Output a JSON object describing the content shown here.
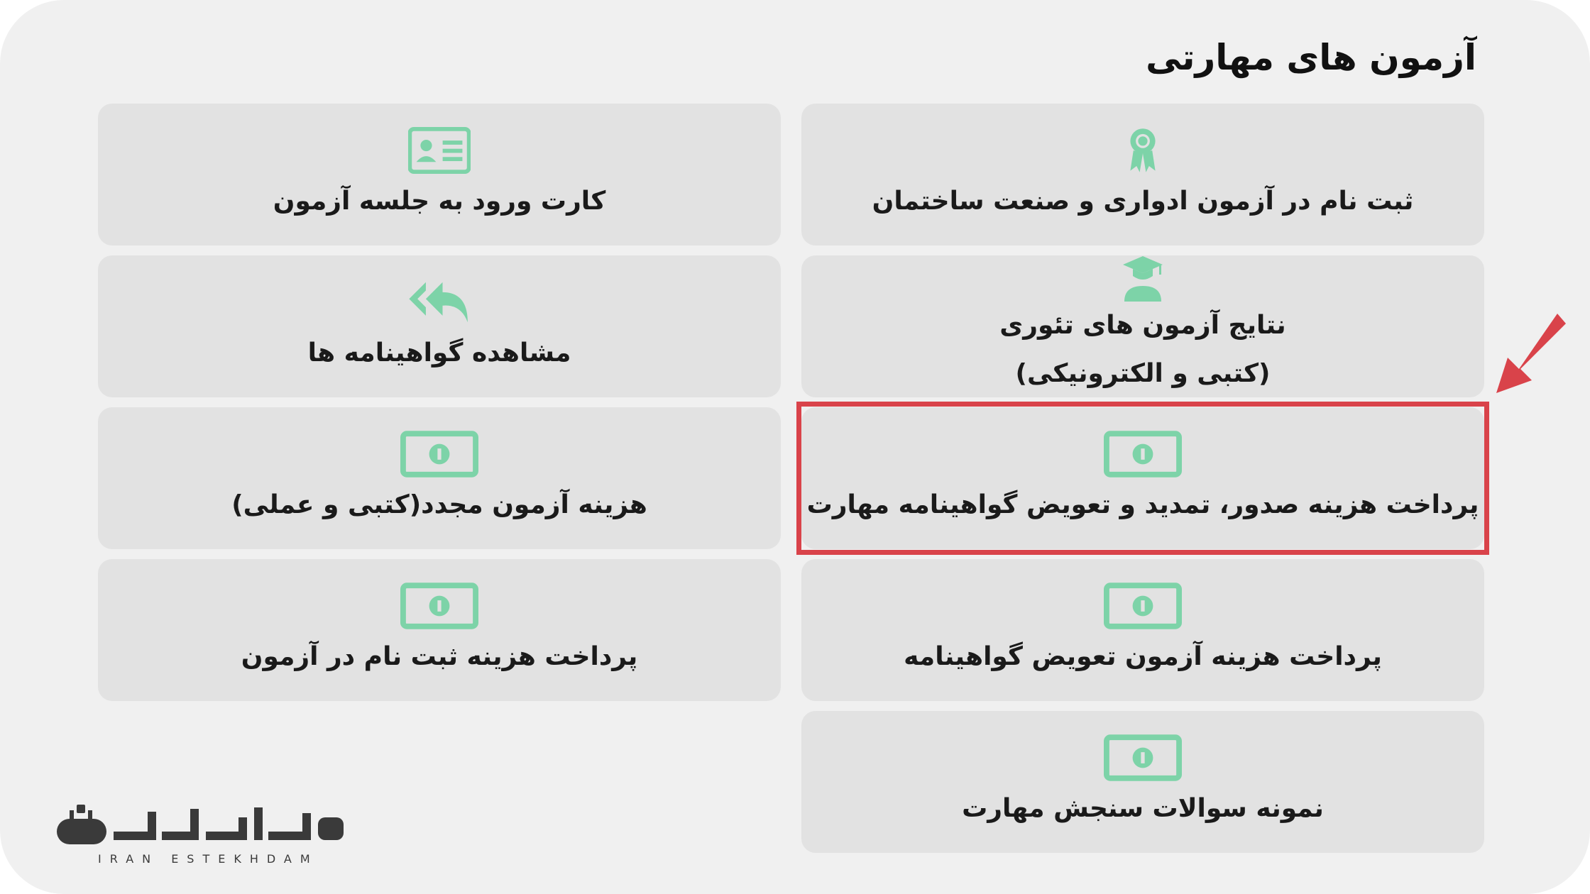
{
  "page": {
    "title": "آزمون های مهارتی"
  },
  "tiles": [
    {
      "label": "ثبت نام در آزمون ادواری و صنعت ساختمان",
      "icon": "award-icon"
    },
    {
      "label": "کارت ورود به جلسه آزمون",
      "icon": "id-card-icon"
    },
    {
      "label": "نتایج آزمون های تئوری",
      "label2": "(کتبی و الکترونیکی)",
      "icon": "graduate-icon"
    },
    {
      "label": "مشاهده گواهینامه ها",
      "icon": "reply-all-icon"
    },
    {
      "label": "پرداخت هزینه صدور، تمدید و تعویض گواهینامه مهارت",
      "icon": "money-bill-icon"
    },
    {
      "label": "هزینه آزمون مجدد(کتبی و عملی)",
      "icon": "money-bill-icon"
    },
    {
      "label": "پرداخت هزینه آزمون تعویض گواهینامه",
      "icon": "money-bill-icon"
    },
    {
      "label": "پرداخت هزینه ثبت نام در آزمون",
      "icon": "money-bill-icon"
    },
    {
      "label": "نمونه سوالات سنجش مهارت",
      "icon": "money-bill-icon"
    }
  ],
  "colors": {
    "icon": "#7dd3a8",
    "tile_bg": "#e2e2e2",
    "highlight": "#d9434a"
  },
  "logo": {
    "text_en": "IRAN ESTEKHDAM"
  }
}
